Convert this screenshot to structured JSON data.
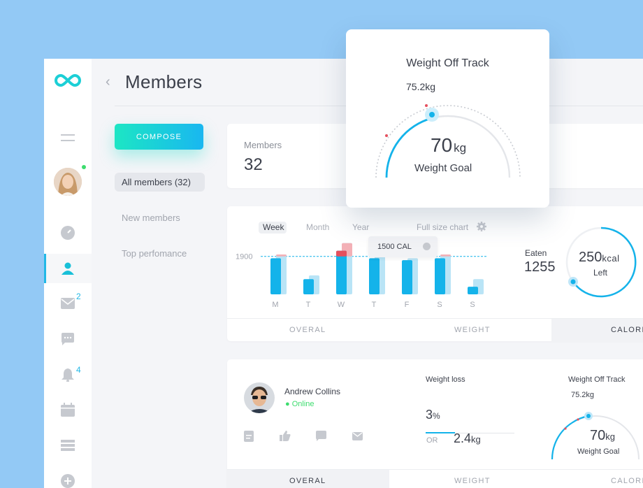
{
  "header": {
    "back_icon": "chevron-left-icon",
    "title": "Members"
  },
  "sidebar": {
    "items": [
      {
        "icon": "menu-icon"
      },
      {
        "icon": "avatar"
      },
      {
        "icon": "gauge-icon"
      },
      {
        "icon": "user-icon",
        "active": true
      },
      {
        "icon": "mail-icon",
        "badge": "2"
      },
      {
        "icon": "chat-icon"
      },
      {
        "icon": "bell-icon",
        "badge": "4"
      },
      {
        "icon": "calendar-icon"
      },
      {
        "icon": "list-icon"
      },
      {
        "icon": "plus-circle-icon"
      }
    ]
  },
  "actions": {
    "compose_label": "COMPOSE"
  },
  "filters": {
    "all": "All members (32)",
    "new": "New members",
    "top": "Top perfomance"
  },
  "members_card": {
    "label": "Members",
    "value": "32"
  },
  "calories_card": {
    "periods": [
      "Week",
      "Month",
      "Year"
    ],
    "full_size": "Full size chart",
    "tooltip": "1500 CAL",
    "eaten_label": "Eaten",
    "eaten_value": "1255",
    "left_value": "250",
    "left_unit": "kcal",
    "left_label": "Left",
    "tabs": [
      "OVERAL",
      "WEIGHT",
      "CALORI"
    ]
  },
  "chart_data": {
    "type": "bar",
    "categories": [
      "M",
      "T",
      "W",
      "T",
      "F",
      "S",
      "S"
    ],
    "reference_line": {
      "label": "1900",
      "value": 1900
    },
    "series": [
      {
        "values": [
          1850,
          1300,
          2050,
          1850,
          1800,
          1850,
          1100
        ]
      },
      {
        "values": [
          1950,
          1400,
          2250,
          1950,
          1850,
          1950,
          1300
        ]
      }
    ],
    "ylim": [
      900,
      2300
    ],
    "colors": {
      "primary": "#14b3ea",
      "secondary": "#b9e4f6",
      "over": "#e5505e",
      "over_light": "#f3b0b6"
    }
  },
  "member": {
    "name": "Andrew Collins",
    "status": "Online",
    "action_icons": [
      "clipboard-icon",
      "thumbs-up-icon",
      "chat-icon",
      "mail-icon"
    ],
    "weight_loss_label": "Weight loss",
    "weight_loss_pct": "3",
    "weight_loss_pct_unit": "%",
    "or_label": "OR",
    "weight_loss_kg": "2.4",
    "weight_loss_kg_unit": "kg",
    "weight_loss_progress": 0.33,
    "track_title": "Weight Off Track",
    "track_current": "75.2kg",
    "goal_value": "70",
    "goal_unit": "kg",
    "goal_label": "Weight Goal",
    "tabs": [
      "OVERAL",
      "WEIGHT",
      "CALORI"
    ]
  },
  "popup": {
    "title": "Weight Off Track",
    "current": "75.2kg",
    "goal_value": "70",
    "goal_unit": "kg",
    "goal_label": "Weight Goal"
  },
  "colors": {
    "accent": "#19b7f0",
    "teal": "#1ce6c4",
    "alert": "#e5505e",
    "online": "#3ddc6e"
  }
}
